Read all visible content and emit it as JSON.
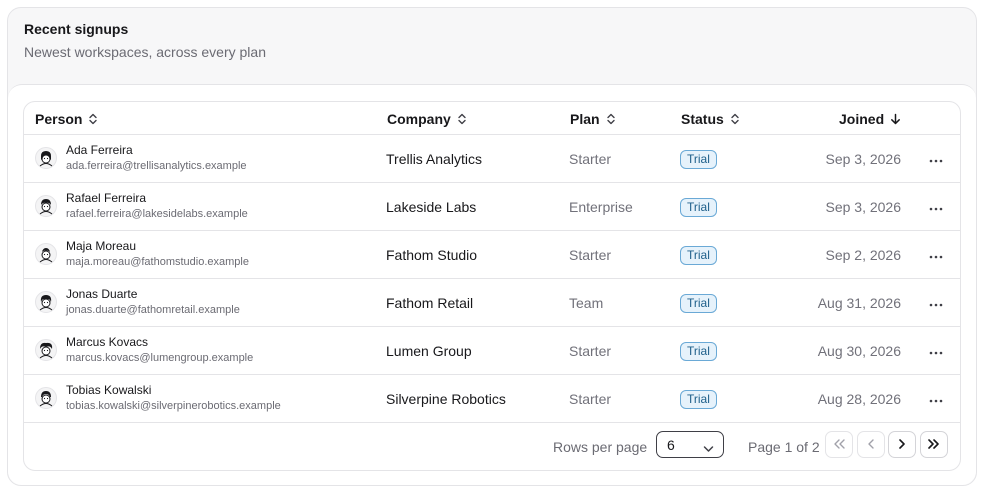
{
  "card": {
    "title": "Recent signups",
    "description": "Newest workspaces, across every plan"
  },
  "table": {
    "columns": {
      "person": "Person",
      "company": "Company",
      "plan": "Plan",
      "status": "Status",
      "joined": "Joined"
    },
    "sort": {
      "column": "joined",
      "direction": "descending"
    },
    "rows": [
      {
        "name": "Ada Ferreira",
        "email": "ada.ferreira@trellisanalytics.example",
        "company": "Trellis Analytics",
        "plan": "Starter",
        "status": "Trial",
        "joined": "Sep 3, 2026"
      },
      {
        "name": "Rafael Ferreira",
        "email": "rafael.ferreira@lakesidelabs.example",
        "company": "Lakeside Labs",
        "plan": "Enterprise",
        "status": "Trial",
        "joined": "Sep 3, 2026"
      },
      {
        "name": "Maja Moreau",
        "email": "maja.moreau@fathomstudio.example",
        "company": "Fathom Studio",
        "plan": "Starter",
        "status": "Trial",
        "joined": "Sep 2, 2026"
      },
      {
        "name": "Jonas Duarte",
        "email": "jonas.duarte@fathomretail.example",
        "company": "Fathom Retail",
        "plan": "Team",
        "status": "Trial",
        "joined": "Aug 31, 2026"
      },
      {
        "name": "Marcus Kovacs",
        "email": "marcus.kovacs@lumengroup.example",
        "company": "Lumen Group",
        "plan": "Starter",
        "status": "Trial",
        "joined": "Aug 30, 2026"
      },
      {
        "name": "Tobias Kowalski",
        "email": "tobias.kowalski@silverpinerobotics.example",
        "company": "Silverpine Robotics",
        "plan": "Starter",
        "status": "Trial",
        "joined": "Aug 28, 2026"
      }
    ]
  },
  "pagination": {
    "rows_per_page_label": "Rows per page",
    "rows_per_page_value": "6",
    "page_label": "Page 1 of 2"
  },
  "colors": {
    "badge_text": "#1e5f8a",
    "badge_bg": "#e6f2fb",
    "badge_border": "#6aa9d6"
  },
  "icons": {
    "sort": "chevrons-up-down-icon",
    "sorted_desc": "arrow-down-icon",
    "more": "more-horizontal-icon",
    "select": "chevron-down-icon",
    "first": "chevrons-left-icon",
    "prev": "chevron-left-icon",
    "next": "chevron-right-icon",
    "last": "chevrons-right-icon"
  }
}
